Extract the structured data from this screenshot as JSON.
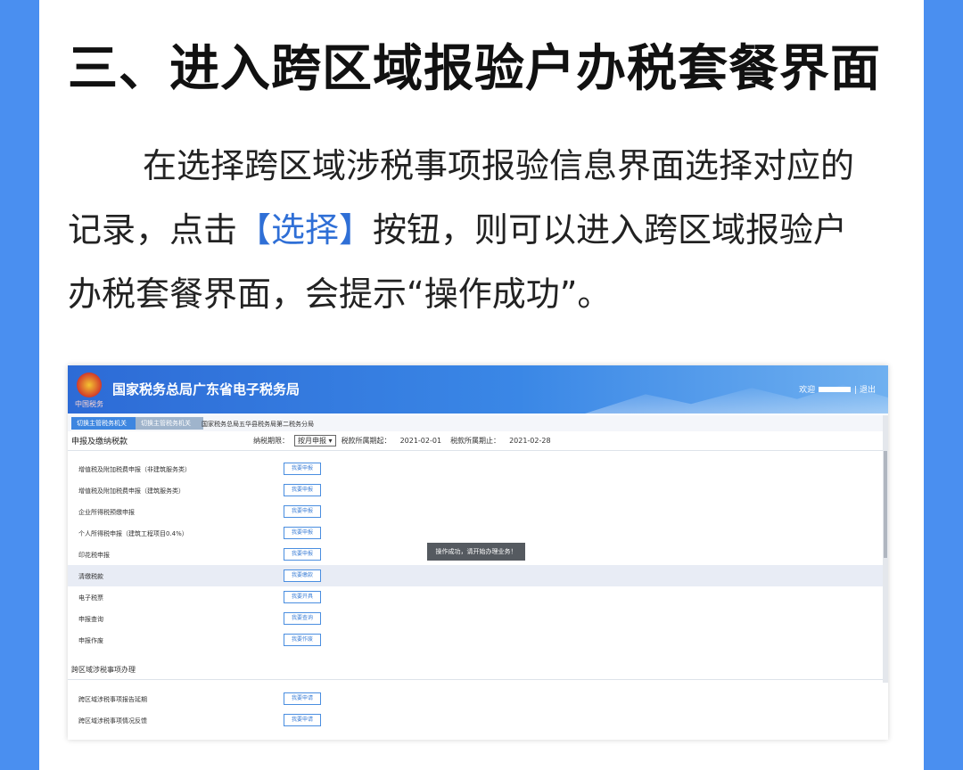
{
  "article": {
    "heading": "三、进入跨区域报验户办税套餐界面",
    "para_before": "在选择跨区域涉税事项报验信息界面选择对应的记录，点击",
    "para_highlight": "【选择】",
    "para_after": "按钮，则可以进入跨区域报验户办税套餐界面，会提示“操作成功”。"
  },
  "screenshot": {
    "site_title": "国家税务总局广东省电子税务局",
    "emblem_caption": "中国税务",
    "welcome": "欢迎",
    "logout": "| 退出",
    "tabs": [
      "切换主管税务机关",
      "切换主管税务机关"
    ],
    "org_name": "国家税务总局五华县税务局第二税务分局",
    "section_title": "申报及缴纳税款",
    "filters": {
      "period_label": "纳税期限：",
      "period_value": "按月申报",
      "start_label": "税款所属期起：",
      "start_value": "2021-02-01",
      "end_label": "税款所属期止：",
      "end_value": "2021-02-28"
    },
    "rows": [
      {
        "label": "增值税及附加税费申报（非建筑服务类）",
        "button": "我要申报"
      },
      {
        "label": "增值税及附加税费申报（建筑服务类）",
        "button": "我要申报"
      },
      {
        "label": "企业所得税预缴申报",
        "button": "我要申报"
      },
      {
        "label": "个人所得税申报（建筑工程项目0.4%）",
        "button": "我要申报"
      },
      {
        "label": "印花税申报",
        "button": "我要申报"
      },
      {
        "label": "清缴税款",
        "button": "我要缴款"
      },
      {
        "label": "电子税票",
        "button": "我要开具"
      },
      {
        "label": "申报查询",
        "button": "我要查询"
      },
      {
        "label": "申报作废",
        "button": "我要作废"
      }
    ],
    "toast": "操作成功，请开始办理业务！",
    "subsection_title": "跨区域涉税事项办理",
    "cross_rows": [
      {
        "label": "跨区域涉税事项报告延期",
        "button": "我要申请"
      },
      {
        "label": "跨区域涉税事项情况反馈",
        "button": "我要申请"
      }
    ]
  }
}
